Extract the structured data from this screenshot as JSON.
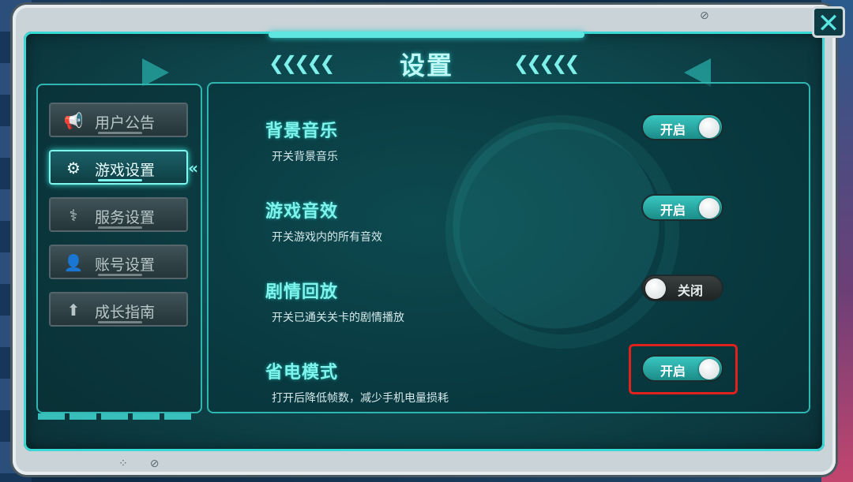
{
  "window": {
    "title": "设置",
    "close_glyph": "✕"
  },
  "sidebar": {
    "items": [
      {
        "label": "用户公告",
        "icon": "megaphone-icon",
        "glyph": "📢",
        "active": false
      },
      {
        "label": "游戏设置",
        "icon": "gear-icon",
        "glyph": "⚙",
        "active": true
      },
      {
        "label": "服务设置",
        "icon": "service-icon",
        "glyph": "⚕",
        "active": false
      },
      {
        "label": "账号设置",
        "icon": "account-icon",
        "glyph": "👤",
        "active": false
      },
      {
        "label": "成长指南",
        "icon": "guide-icon",
        "glyph": "⬆",
        "active": false
      }
    ],
    "active_marker": "«"
  },
  "settings": [
    {
      "title": "背景音乐",
      "desc": "开关背景音乐",
      "state": "on",
      "toggle_label": "开启"
    },
    {
      "title": "游戏音效",
      "desc": "开关游戏内的所有音效",
      "state": "on",
      "toggle_label": "开启"
    },
    {
      "title": "剧情回放",
      "desc": "开关已通关关卡的剧情播放",
      "state": "off",
      "toggle_label": "关闭"
    },
    {
      "title": "省电模式",
      "desc": "打开后降低帧数，减少手机电量损耗",
      "state": "on",
      "toggle_label": "开启"
    }
  ],
  "colors": {
    "accent": "#7ff4ec",
    "toggle_on": "#39c6c1",
    "toggle_off": "#2b3031",
    "highlight": "#e0221d"
  },
  "decor": {
    "bottom_icons": "⁘⊘",
    "top_icon": "⊘",
    "chevrons": "❮❮❮❮❮"
  }
}
